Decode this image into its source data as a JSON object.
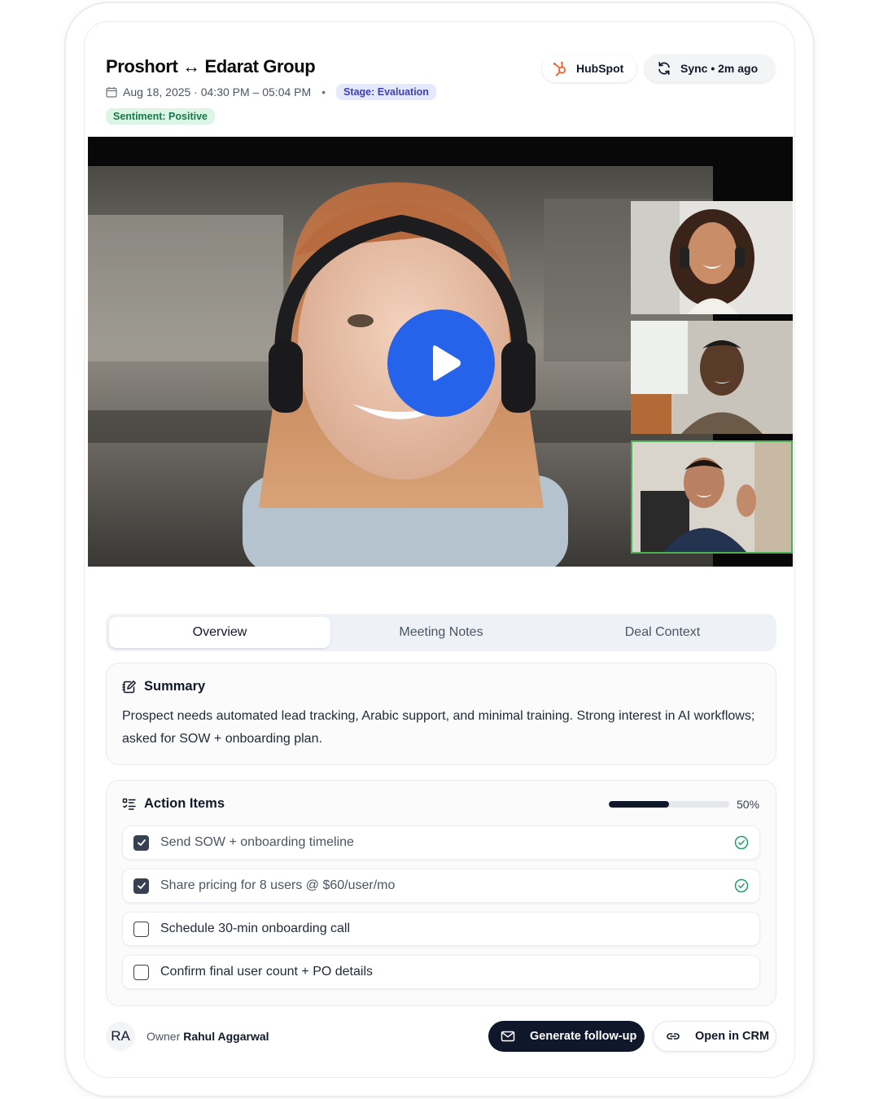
{
  "header": {
    "title": "Proshort ↔ Edarat Group",
    "datetime": "Aug 18, 2025 · 04:30 PM – 05:04 PM",
    "separator": "•",
    "stage": "Stage: Evaluation",
    "sentiment": "Sentiment: Positive"
  },
  "integrations": {
    "hubspot_label": "HubSpot",
    "sync_label": "Sync • 2m ago"
  },
  "video": {
    "play_icon": "play-icon"
  },
  "tabs": [
    {
      "label": "Overview",
      "active": true
    },
    {
      "label": "Meeting Notes",
      "active": false
    },
    {
      "label": "Deal Context",
      "active": false
    }
  ],
  "summary": {
    "heading": "Summary",
    "text": "Prospect needs automated lead tracking, Arabic support, and minimal training. Strong interest in AI workflows; asked for SOW + onboarding plan."
  },
  "actions": {
    "heading": "Action Items",
    "progress_value": 0.5,
    "progress_label": "50%",
    "items": [
      {
        "label": "Send SOW + onboarding timeline",
        "checked": true
      },
      {
        "label": "Share pricing for 8 users @ $60/user/mo",
        "checked": true
      },
      {
        "label": "Schedule 30-min onboarding call",
        "checked": false
      },
      {
        "label": "Confirm final user count + PO details",
        "checked": false
      }
    ]
  },
  "footer": {
    "avatar_initials": "RA",
    "owner_label": "Owner",
    "owner_name": "Rahul Aggarwal",
    "primary_button": "Generate follow-up",
    "secondary_button": "Open in CRM"
  },
  "colors": {
    "accent": "#2563eb",
    "stage_bg": "#e6e9fd",
    "sentiment_bg": "#dcf5e6",
    "hubspot": "#f26b3a",
    "success": "#22a06b"
  }
}
